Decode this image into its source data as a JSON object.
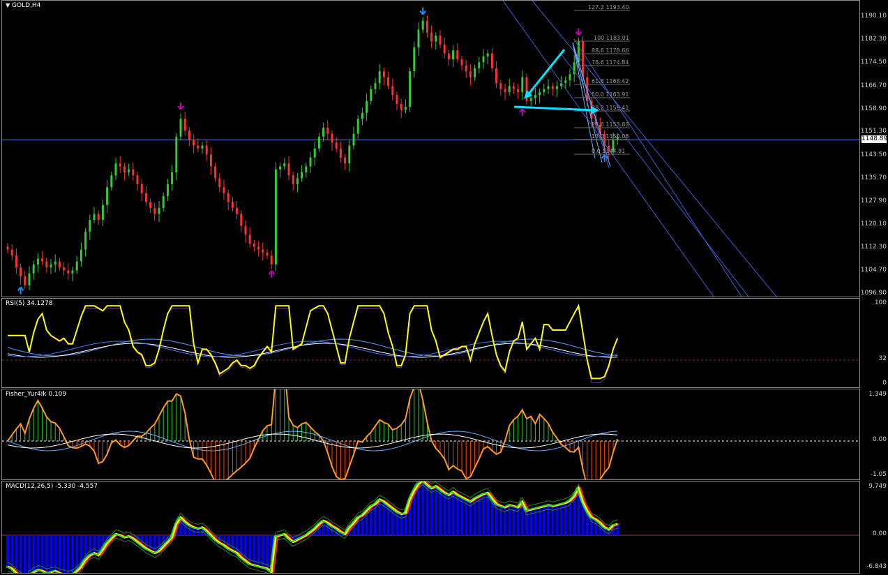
{
  "main": {
    "symbol_title": "GOLD,H4",
    "price_ticks": [
      "1190.10",
      "1182.30",
      "1174.50",
      "1166.70",
      "1158.90",
      "1151.30",
      "1143.50",
      "1135.70",
      "1127.90",
      "1120.10",
      "1112.30",
      "1104.70",
      "1096.90"
    ],
    "current_price": "1148.89",
    "fib_levels": [
      {
        "label": "127.2  1193.40"
      },
      {
        "label": "100  1183.01"
      },
      {
        "label": "88.6  1178.66"
      },
      {
        "label": "78.6  1174.84"
      },
      {
        "label": "61.8  1168.42"
      },
      {
        "label": "50.0  1163.91"
      },
      {
        "label": "38.2  1159.41"
      },
      {
        "label": "23.6  1153.83"
      },
      {
        "label": "13.0  1150.08"
      },
      {
        "label": "0.0  1144.81"
      }
    ]
  },
  "rsi": {
    "title": "RSI(5) 34.1278",
    "ticks": [
      "100",
      "32",
      "0"
    ]
  },
  "fisher": {
    "title": "Fisher_Yur4ik 0.109",
    "ticks": [
      "1.349",
      "0.00",
      "-1.05"
    ]
  },
  "macd": {
    "title": "MACD(12,26,5) -5.330 -4.557",
    "ticks": [
      "9.749",
      "0.00",
      "-6.843"
    ]
  },
  "colors": {
    "bull": "#32cd32",
    "bear": "#ff3030",
    "grid": "#8c8c8c",
    "rsi": "#ffff00",
    "fisher_up": "#32cd32",
    "fisher_dn": "#ff4500",
    "macd_hist": "#0000ff",
    "cyan": "#00e5ff",
    "arrow_up": "#1e90ff",
    "arrow_mag": "#c000c0"
  },
  "chart_data": {
    "type": "candlestick",
    "instrument": "GOLD",
    "timeframe": "H4",
    "ylim": [
      1096.9,
      1196.0
    ],
    "closes": [
      1112,
      1110,
      1106,
      1103,
      1100,
      1104,
      1107,
      1109,
      1108,
      1106,
      1107,
      1108,
      1106,
      1105,
      1104,
      1105,
      1108,
      1112,
      1118,
      1122,
      1124,
      1122,
      1127,
      1133,
      1137,
      1141,
      1140,
      1138,
      1139,
      1137,
      1134,
      1131,
      1128,
      1126,
      1124,
      1126,
      1130,
      1134,
      1138,
      1150,
      1156,
      1152,
      1149,
      1147,
      1146,
      1147,
      1144,
      1140,
      1136,
      1133,
      1131,
      1128,
      1126,
      1124,
      1120,
      1117,
      1114,
      1113,
      1112,
      1111,
      1110,
      1107,
      1139,
      1140,
      1141,
      1137,
      1134,
      1136,
      1138,
      1140,
      1143,
      1146,
      1150,
      1153,
      1151,
      1148,
      1146,
      1143,
      1141,
      1147,
      1151,
      1156,
      1158,
      1162,
      1166,
      1168,
      1172,
      1170,
      1167,
      1164,
      1161,
      1159,
      1160,
      1172,
      1180,
      1186,
      1189,
      1185,
      1182,
      1184,
      1181,
      1178,
      1176,
      1179,
      1176,
      1174,
      1172,
      1170,
      1173,
      1175,
      1177,
      1178,
      1173,
      1168,
      1166,
      1165,
      1167,
      1166,
      1165,
      1170,
      1162,
      1163,
      1164,
      1165,
      1166,
      1167,
      1166,
      1167,
      1168,
      1169,
      1171,
      1175,
      1182,
      1170,
      1162,
      1156,
      1154,
      1151,
      1147,
      1145,
      1149,
      1150
    ]
  }
}
